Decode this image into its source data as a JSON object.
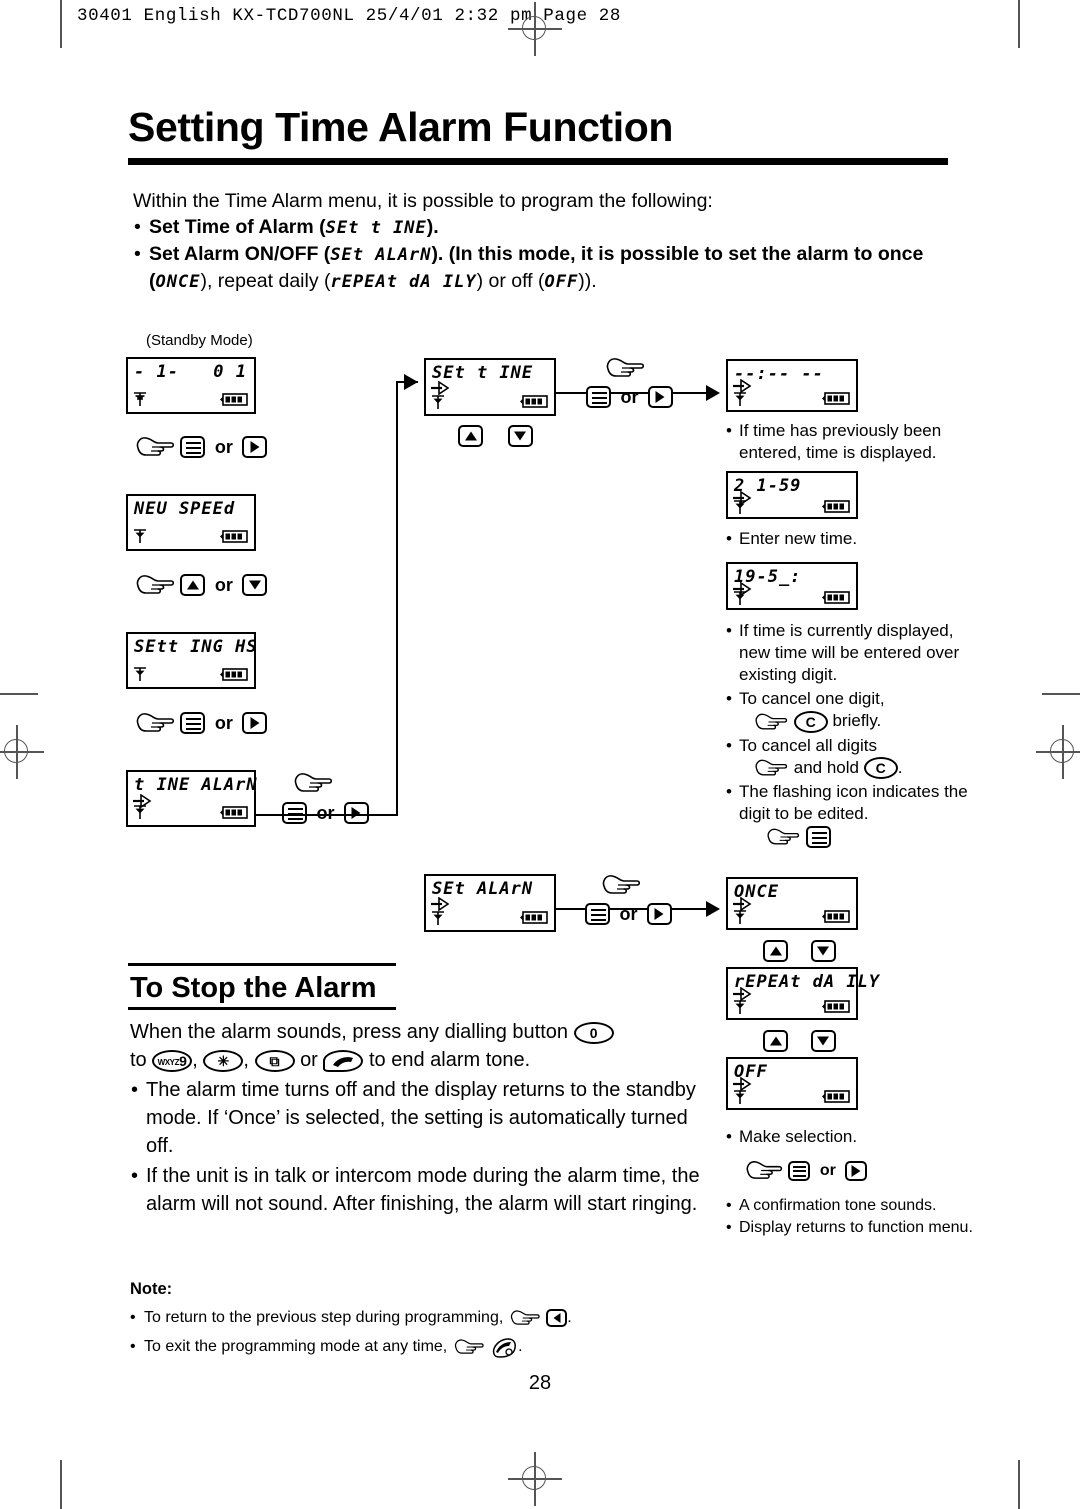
{
  "header": {
    "print_info": "30401 English KX-TCD700NL  25/4/01  2:32 pm  Page 28"
  },
  "page": {
    "title": "Setting Time Alarm Function",
    "number": "28"
  },
  "intro": {
    "lead": "Within the Time Alarm menu, it is possible to program the following:",
    "bullet1_pre": "Set Time of Alarm (",
    "bullet1_lcd": "SEt t INE",
    "bullet1_post": ").",
    "bullet2_pre": "Set Alarm ON/OFF (",
    "bullet2_lcd": "SEt ALArN",
    "bullet2_mid": "). (In this mode, it is possible to set the alarm to once (",
    "bullet2_lcd2": "ONCE",
    "bullet2_mid2": "), repeat daily (",
    "bullet2_lcd3": "rEPEAt dA ILY",
    "bullet2_mid3": ") or off (",
    "bullet2_lcd4": "OFF",
    "bullet2_post": "))."
  },
  "flow": {
    "standby_label": "(Standby Mode)",
    "screens": {
      "standby_left": "- 1-",
      "standby_right": "0 1",
      "new_speed": "NEU SPEEd",
      "settings_hs": "SEtt ING HS",
      "time_alarm": "t INE ALArN",
      "set_time": "SEt t INE",
      "time_blank": "--:-- --",
      "time_prev": "2 1-59",
      "time_new": "19-5_:",
      "set_alarm": "SEt ALArN",
      "once": "ONCE",
      "repeat_daily": "rEPEAt dA ILY",
      "off": "OFF"
    },
    "or_label": "or",
    "keys": {
      "menu": "menu-key",
      "right": "right-arrow-key",
      "left": "left-arrow-key",
      "up": "up-arrow-key",
      "down": "down-arrow-key"
    }
  },
  "right_notes": {
    "n1": "If time has previously been entered, time is displayed.",
    "n2": "Enter new time.",
    "n3": "If time is currently displayed, new time will be entered over existing digit.",
    "n4_pre": "To cancel one digit,",
    "n4_key": "C",
    "n4_post": "briefly.",
    "n5_pre": "To cancel all digits",
    "n5_mid": "and hold",
    "n5_key": "C",
    "n5_post": ".",
    "n6": "The flashing icon indicates the digit to be edited.",
    "n7": "Make selection.",
    "n8": "A confirmation tone sounds.",
    "n9": "Display returns to function menu."
  },
  "stop_alarm": {
    "heading": "To Stop the Alarm",
    "line1_pre": "When the alarm sounds, press any dialling button",
    "key_zero": "0",
    "line1_mid": "to",
    "key_nine_sup": "WXYZ",
    "key_nine": "9",
    "key_star": "✳",
    "key_hash": "⧉",
    "line1_mid2": "or",
    "line1_post": "to end alarm tone.",
    "bullet1": "The alarm time turns off and the display returns to the standby mode. If ‘Once’ is selected, the setting is automatically turned off.",
    "bullet2": "If the unit is in talk or intercom mode during the alarm time, the alarm will not sound. After finishing, the alarm will start ringing."
  },
  "note": {
    "heading": "Note:",
    "line1_pre": "To return to the previous step during programming,",
    "line1_post": ".",
    "line2_pre": "To exit the programming mode at any time,",
    "line2_post": "."
  }
}
